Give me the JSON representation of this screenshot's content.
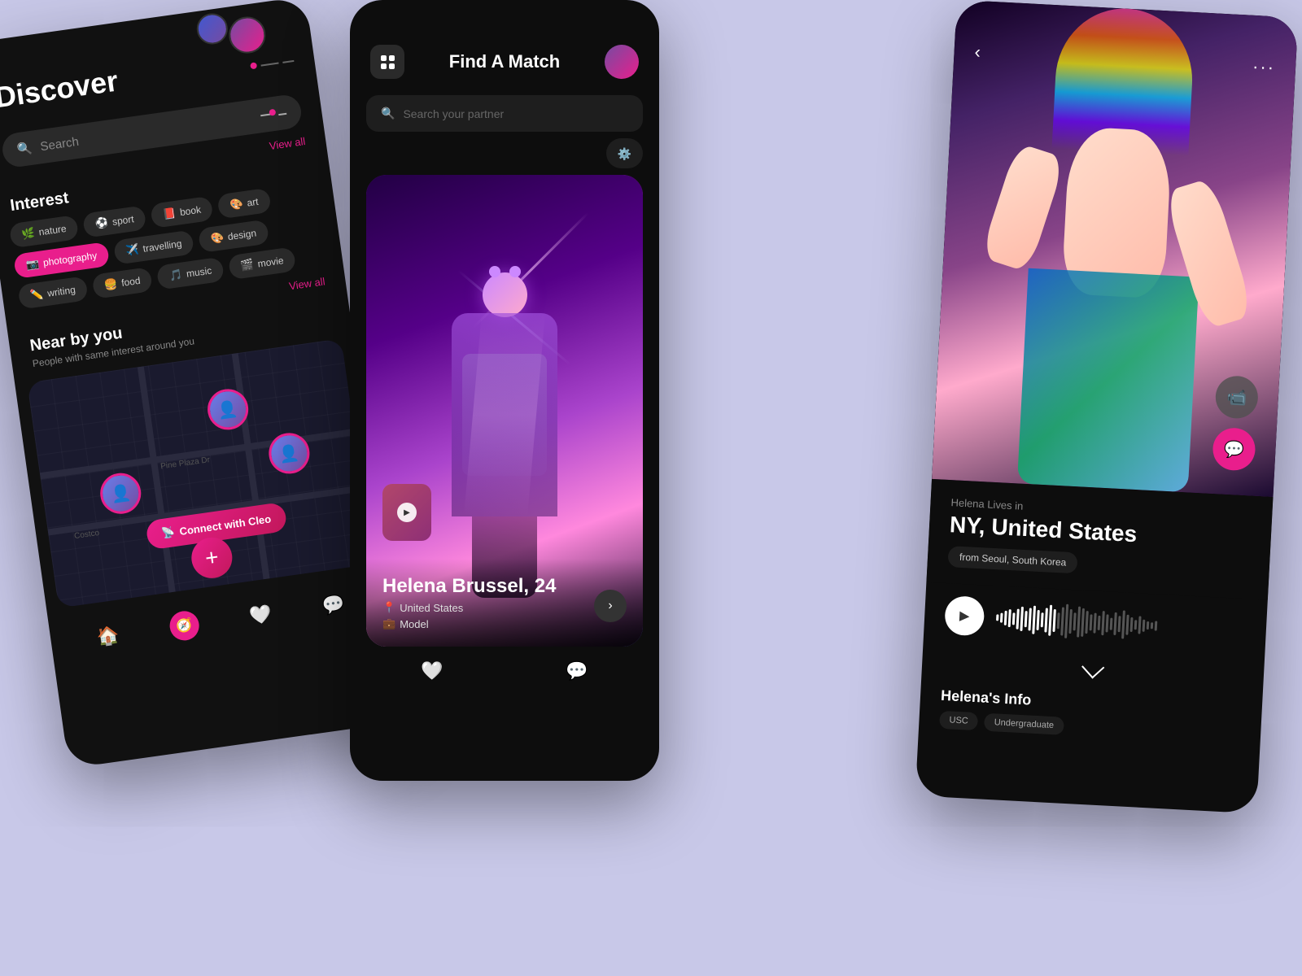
{
  "background_color": "#c8c8e8",
  "phone1": {
    "title": "Discover",
    "search_placeholder": "Search",
    "view_all_1": "View all",
    "interest_title": "Interest",
    "tags": [
      {
        "label": "nature",
        "emoji": "🌿",
        "active": false
      },
      {
        "label": "sport",
        "emoji": "⚽",
        "active": false
      },
      {
        "label": "book",
        "emoji": "📕",
        "active": false
      },
      {
        "label": "art",
        "emoji": "🎨",
        "active": false
      },
      {
        "label": "photography",
        "emoji": "📷",
        "active": true
      },
      {
        "label": "travelling",
        "emoji": "✈️",
        "active": false
      },
      {
        "label": "design",
        "emoji": "🎨",
        "active": false
      },
      {
        "label": "writing",
        "emoji": "✏️",
        "active": false
      },
      {
        "label": "food",
        "emoji": "🍔",
        "active": false
      },
      {
        "label": "music",
        "emoji": "🎵",
        "active": false
      },
      {
        "label": "movie",
        "emoji": "🎬",
        "active": false
      }
    ],
    "view_all_2": "View all",
    "nearby_title": "Near by you",
    "nearby_subtitle": "People with same interest around you",
    "map_label": "Pine Plaza Dr",
    "map_label2": "Costco",
    "connect_btn": "Connect with Cleo",
    "nav_items": [
      "home",
      "compass",
      "plus",
      "heart",
      "chat"
    ]
  },
  "phone2": {
    "title": "Find A Match",
    "search_placeholder": "Search your partner",
    "card": {
      "name": "Helena Brussel, 24",
      "location": "United States",
      "profession": "Model"
    },
    "nav_items": [
      "heart",
      "chat"
    ]
  },
  "phone3": {
    "more_icon": "···",
    "lives_in": "Helena Lives in",
    "location": "NY, United States",
    "from_badge": "from Seoul, South Korea",
    "info_title": "Helena's Info",
    "info_items": [
      "USC",
      "Undergraduate"
    ],
    "audio_waveform_bars": 40
  }
}
